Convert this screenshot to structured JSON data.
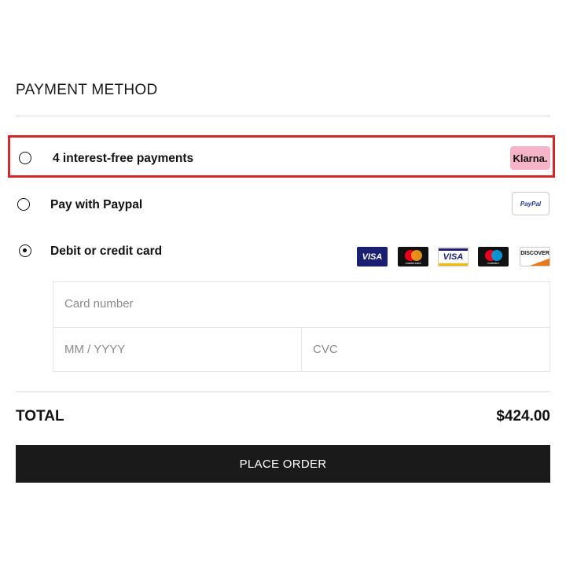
{
  "payment": {
    "section_title": "PAYMENT METHOD",
    "options": [
      {
        "label": "4 interest-free payments",
        "badge": "Klarna.",
        "selected": false,
        "highlighted": true
      },
      {
        "label": "Pay with Paypal",
        "badge": "PayPal",
        "selected": false
      },
      {
        "label": "Debit or credit card",
        "selected": true
      }
    ],
    "cards": [
      {
        "name": "visa-icon",
        "text": "VISA"
      },
      {
        "name": "mastercard-icon",
        "text": "mastercard"
      },
      {
        "name": "visa-electron-icon",
        "text": "VISA"
      },
      {
        "name": "maestro-icon",
        "text": "maestro"
      },
      {
        "name": "discover-icon",
        "text": "DISCOVER"
      }
    ],
    "card_form": {
      "card_number_placeholder": "Card number",
      "expiry_placeholder": "MM / YYYY",
      "cvc_placeholder": "CVC"
    }
  },
  "summary": {
    "total_label": "TOTAL",
    "total_value": "$424.00"
  },
  "actions": {
    "place_order_label": "PLACE ORDER"
  },
  "colors": {
    "highlight": "#d0282b",
    "klarna_pink": "#f5b4c7",
    "button_bg": "#1a1a1a",
    "visa_blue": "#1a1f71"
  }
}
